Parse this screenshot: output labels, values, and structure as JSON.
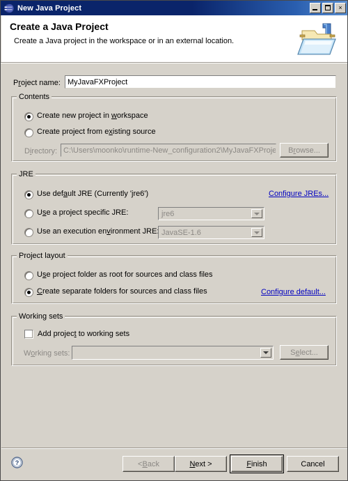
{
  "window": {
    "title": "New Java Project",
    "icon": "eclipse-globe-icon",
    "controls": {
      "minimize": "minimize-button",
      "maximize": "maximize-button",
      "close": "×"
    }
  },
  "header": {
    "title": "Create a Java Project",
    "subtitle": "Create a Java project in the workspace or in an external location.",
    "banner_icon": "java-project-folder-icon"
  },
  "project_name": {
    "label_pre": "P",
    "label_mnemonic": "r",
    "label_post": "oject name:",
    "label_full": "Project name:",
    "value": "MyJavaFXProject"
  },
  "contents": {
    "group_label": "Contents",
    "option_workspace": {
      "pre": "Create new project in ",
      "mnemonic": "w",
      "post": "orkspace",
      "full": "Create new project in workspace",
      "selected": true
    },
    "option_existing": {
      "pre": "Create project from e",
      "mnemonic": "x",
      "post": "isting source",
      "full": "Create project from existing source",
      "selected": false
    },
    "directory": {
      "label_pre": "D",
      "label_mnemonic": "i",
      "label_post": "rectory:",
      "label_full": "Directory:",
      "value": "C:\\Users\\moonko\\runtime-New_configuration2\\MyJavaFXProje",
      "enabled": false
    },
    "browse_button": {
      "pre": "B",
      "mnemonic": "r",
      "post": "owse...",
      "full": "Browse...",
      "enabled": false
    }
  },
  "jre": {
    "group_label": "JRE",
    "option_default": {
      "pre": "Use def",
      "mnemonic": "a",
      "post": "ult JRE (Currently 'jre6')",
      "full": "Use default JRE (Currently 'jre6')",
      "selected": true
    },
    "option_specific": {
      "pre": "U",
      "mnemonic": "s",
      "post": "e a project specific JRE:",
      "full": "Use a project specific JRE:",
      "selected": false
    },
    "option_execenv": {
      "pre": "Use an execution en",
      "mnemonic": "v",
      "post": "ironment JRE:",
      "full": "Use an execution environment JRE:",
      "selected": false
    },
    "specific_combo": {
      "value": "jre6",
      "enabled": false
    },
    "execenv_combo": {
      "value": "JavaSE-1.6",
      "enabled": false
    },
    "configure_link": "Configure JREs..."
  },
  "project_layout": {
    "group_label": "Project layout",
    "option_root": {
      "pre": "U",
      "mnemonic": "s",
      "post": "e project folder as root for sources and class files",
      "full": "Use project folder as root for sources and class files",
      "selected": false
    },
    "option_separate": {
      "pre": "",
      "mnemonic": "C",
      "post": "reate separate folders for sources and class files",
      "full": "Create separate folders for sources and class files",
      "selected": true
    },
    "configure_link": "Configure default..."
  },
  "working_sets": {
    "group_label": "Working sets",
    "checkbox": {
      "pre": "Add projec",
      "mnemonic": "t",
      "post": " to working sets",
      "full": "Add project to working sets",
      "checked": false
    },
    "combo_label_pre": "W",
    "combo_label_mnemonic": "o",
    "combo_label_post": "rking sets:",
    "combo_label_full": "Working sets:",
    "combo_value": "",
    "select_button": {
      "pre": "S",
      "mnemonic": "e",
      "post": "lect...",
      "full": "Select...",
      "enabled": false
    }
  },
  "footer": {
    "help_icon": "help-question-icon",
    "back": {
      "pre": "< ",
      "mnemonic": "B",
      "post": "ack",
      "full": "< Back",
      "enabled": false
    },
    "next": {
      "pre": "",
      "mnemonic": "N",
      "post": "ext >",
      "full": "Next >",
      "enabled": true
    },
    "finish": {
      "pre": "",
      "mnemonic": "F",
      "post": "inish",
      "full": "Finish",
      "enabled": true,
      "is_default": true
    },
    "cancel": {
      "pre": "",
      "mnemonic": "",
      "post": "Cancel",
      "full": "Cancel",
      "enabled": true
    }
  },
  "colors": {
    "dialog_bg": "#d6d2ca",
    "titlebar": "#0a246a",
    "header_bg": "#ffffff",
    "link": "#0000c0",
    "disabled_text": "#8b8884"
  }
}
